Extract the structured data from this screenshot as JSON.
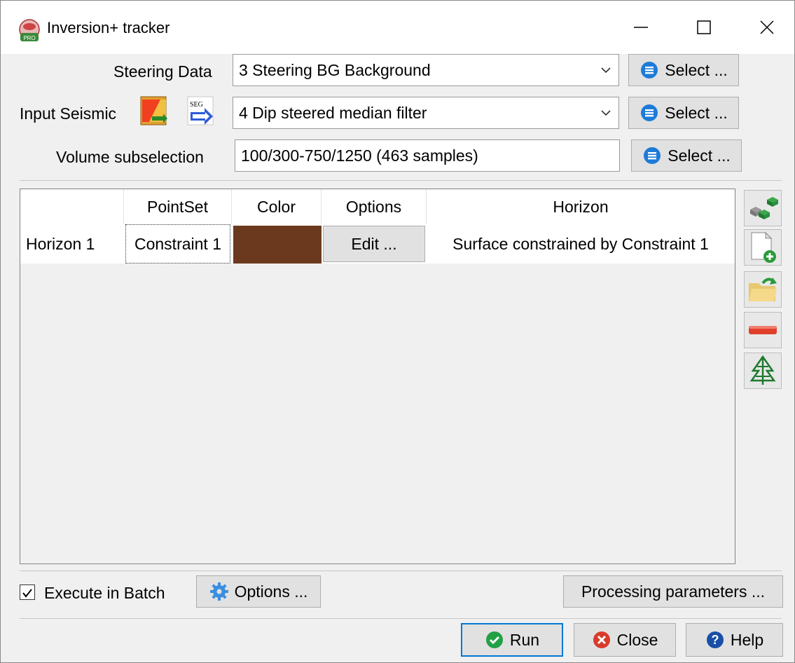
{
  "window": {
    "title": "Inversion+ tracker"
  },
  "form": {
    "steering_label": "Steering Data",
    "steering_value": "3 Steering BG Background",
    "input_label": "Input Seismic",
    "input_value": "4 Dip steered median filter",
    "volume_label": "Volume subselection",
    "volume_value": "100/300-750/1250 (463 samples)",
    "select_label": "Select ..."
  },
  "table": {
    "columns": [
      "PointSet",
      "Color",
      "Options",
      "Horizon"
    ],
    "rows": [
      {
        "name": "Horizon 1",
        "pointset": "Constraint 1",
        "color": "#6b3a1e",
        "options": "Edit ...",
        "horizon": "Surface constrained by Constraint 1"
      }
    ]
  },
  "bottom": {
    "execute_batch": "Execute in Batch",
    "execute_checked": true,
    "options_label": "Options ...",
    "processing_label": "Processing parameters ...",
    "run_label": "Run",
    "close_label": "Close",
    "help_label": "Help"
  },
  "colors": {
    "accent": "#0078d7",
    "select_icon": "#1e7bd8",
    "run_green": "#22a046",
    "close_red": "#d93a2b",
    "help_blue": "#1a4fa8"
  }
}
